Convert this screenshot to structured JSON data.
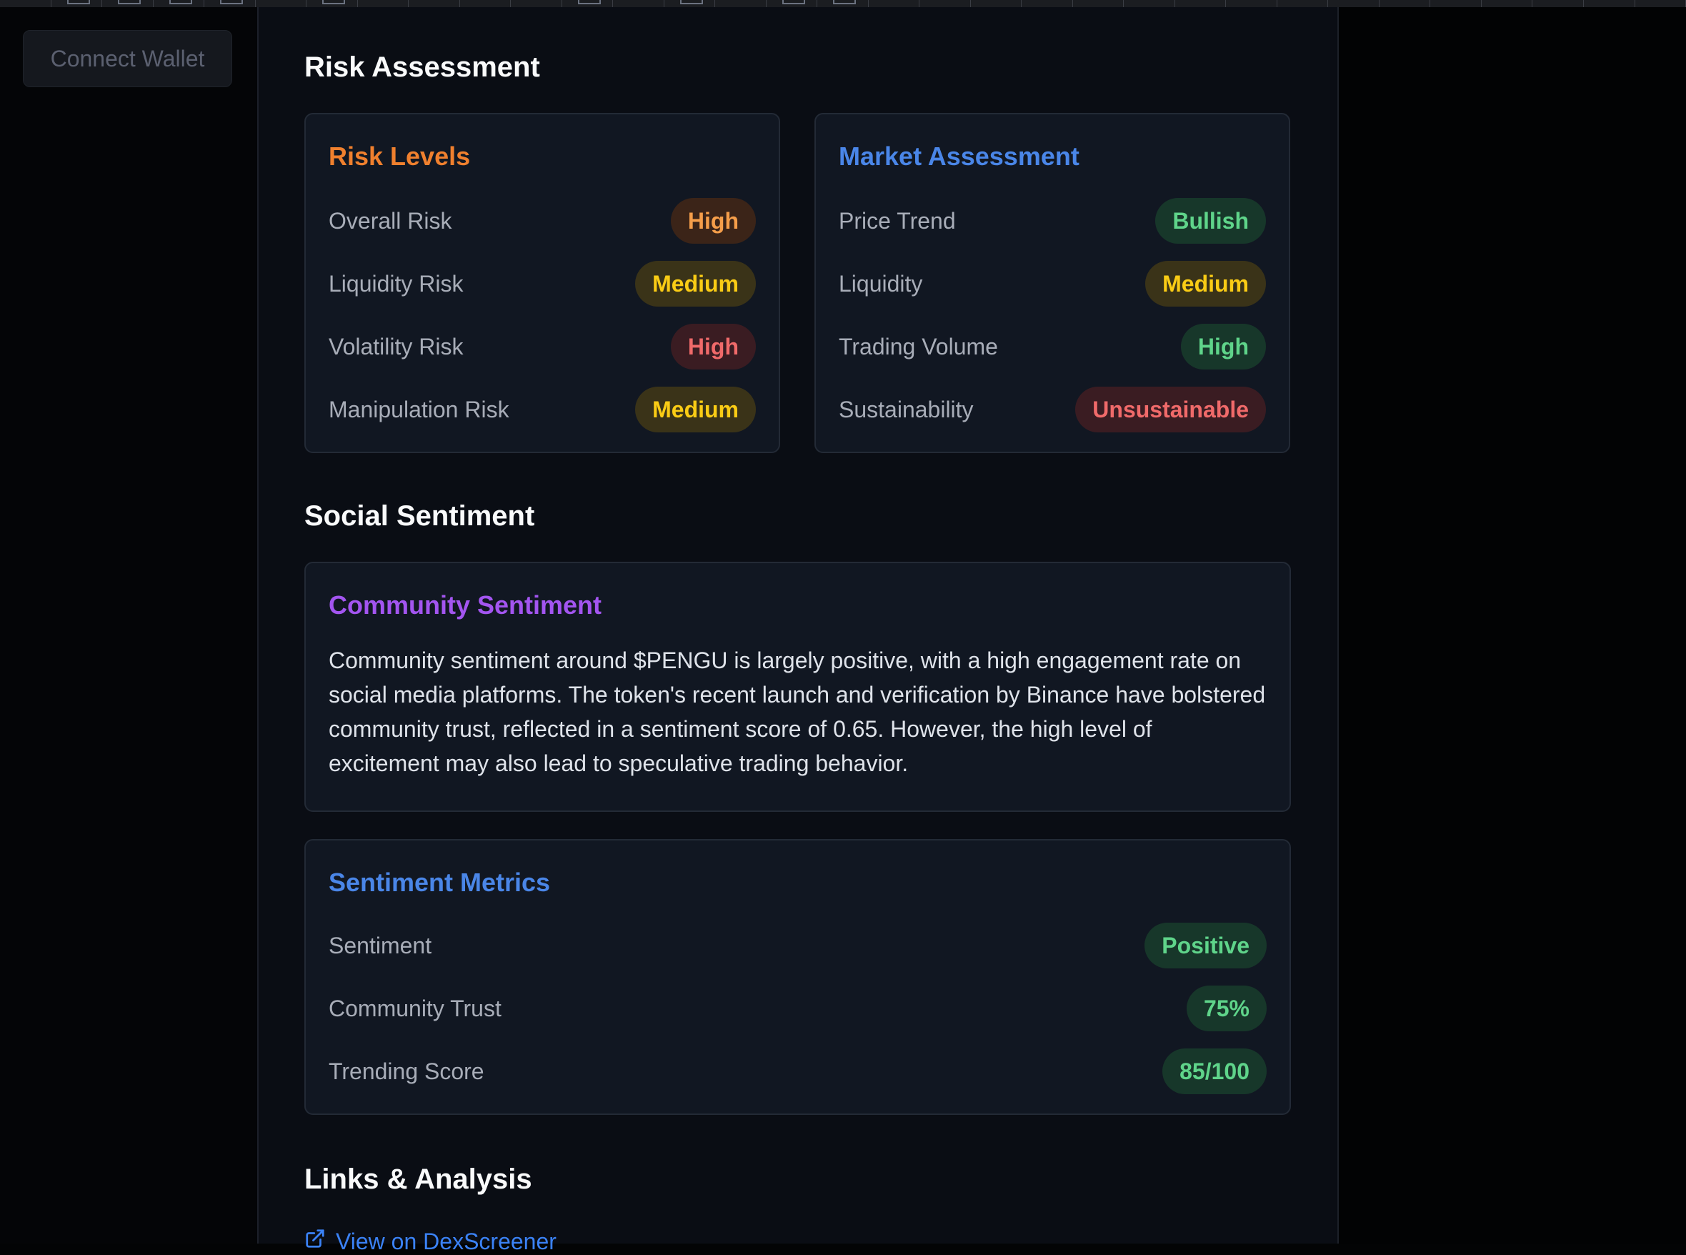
{
  "sidebar": {
    "connect_wallet_label": "Connect Wallet"
  },
  "risk_assessment": {
    "title": "Risk Assessment",
    "risk_levels": {
      "title": "Risk Levels",
      "title_color": "#f0802e",
      "rows": [
        {
          "label": "Overall Risk",
          "value": "High",
          "tone": "orange"
        },
        {
          "label": "Liquidity Risk",
          "value": "Medium",
          "tone": "yellow"
        },
        {
          "label": "Volatility Risk",
          "value": "High",
          "tone": "red"
        },
        {
          "label": "Manipulation Risk",
          "value": "Medium",
          "tone": "yellow"
        }
      ]
    },
    "market_assessment": {
      "title": "Market Assessment",
      "title_color": "#4a86e8",
      "rows": [
        {
          "label": "Price Trend",
          "value": "Bullish",
          "tone": "green"
        },
        {
          "label": "Liquidity",
          "value": "Medium",
          "tone": "yellow"
        },
        {
          "label": "Trading Volume",
          "value": "High",
          "tone": "green"
        },
        {
          "label": "Sustainability",
          "value": "Unsustainable",
          "tone": "red"
        }
      ]
    }
  },
  "social_sentiment": {
    "title": "Social Sentiment",
    "community_sentiment": {
      "title": "Community Sentiment",
      "title_color": "#a355f0",
      "text": "Community sentiment around $PENGU is largely positive, with a high engagement rate on social media platforms. The token's recent launch and verification by Binance have bolstered community trust, reflected in a sentiment score of 0.65. However, the high level of excitement may also lead to speculative trading behavior."
    },
    "sentiment_metrics": {
      "title": "Sentiment Metrics",
      "title_color": "#4a86e8",
      "rows": [
        {
          "label": "Sentiment",
          "value": "Positive",
          "tone": "green"
        },
        {
          "label": "Community Trust",
          "value": "75%",
          "tone": "green"
        },
        {
          "label": "Trending Score",
          "value": "85/100",
          "tone": "green"
        }
      ]
    }
  },
  "links": {
    "title": "Links & Analysis",
    "dexscreener_label": "View on DexScreener",
    "icon": "external-link-icon",
    "color": "#3b82f6"
  }
}
